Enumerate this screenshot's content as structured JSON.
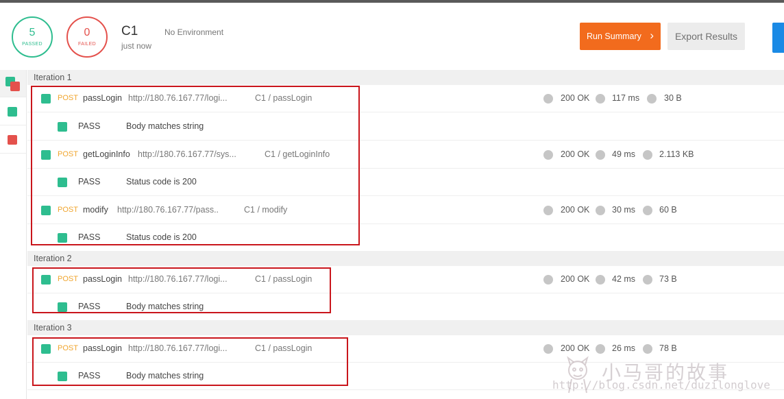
{
  "header": {
    "passed": {
      "count": "5",
      "label": "PASSED"
    },
    "failed": {
      "count": "0",
      "label": "FAILED"
    },
    "collection": "C1",
    "time": "just now",
    "environment": "No Environment",
    "run_summary_label": "Run Summary",
    "export_label": "Export Results"
  },
  "colors": {
    "pass": "#2ebd8f",
    "fail": "#e4514c",
    "method": "#f0a52e",
    "primary": "#f26b1d",
    "highlight": "#c9151b"
  },
  "iterations": [
    {
      "title": "Iteration 1",
      "requests": [
        {
          "method": "POST",
          "name": "passLogin",
          "url": "http://180.76.167.77/logi...",
          "path": "C1 / passLogin",
          "status": "200 OK",
          "time": "117 ms",
          "size": "30 B",
          "test_result": "PASS",
          "test_name": "Body matches string"
        },
        {
          "method": "POST",
          "name": "getLoginInfo",
          "url": "http://180.76.167.77/sys...",
          "path": "C1 / getLoginInfo",
          "status": "200 OK",
          "time": "49 ms",
          "size": "2.113 KB",
          "test_result": "PASS",
          "test_name": "Status code is 200"
        },
        {
          "method": "POST",
          "name": "modify",
          "url": "http://180.76.167.77/pass..",
          "path": "C1 / modify",
          "status": "200 OK",
          "time": "30 ms",
          "size": "60 B",
          "test_result": "PASS",
          "test_name": "Status code is 200"
        }
      ]
    },
    {
      "title": "Iteration 2",
      "requests": [
        {
          "method": "POST",
          "name": "passLogin",
          "url": "http://180.76.167.77/logi...",
          "path": "C1 / passLogin",
          "status": "200 OK",
          "time": "42 ms",
          "size": "73 B",
          "test_result": "PASS",
          "test_name": "Body matches string"
        }
      ]
    },
    {
      "title": "Iteration 3",
      "requests": [
        {
          "method": "POST",
          "name": "passLogin",
          "url": "http://180.76.167.77/logi...",
          "path": "C1 / passLogin",
          "status": "200 OK",
          "time": "26 ms",
          "size": "78 B",
          "test_result": "PASS",
          "test_name": "Body matches string"
        }
      ]
    }
  ],
  "watermark": {
    "text": "小马哥的故事",
    "url": "http://blog.csdn.net/duzilonglove"
  }
}
